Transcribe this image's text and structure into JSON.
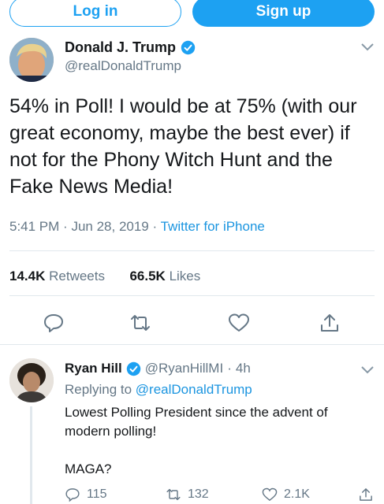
{
  "auth": {
    "login_label": "Log in",
    "signup_label": "Sign up"
  },
  "main_tweet": {
    "author_name": "Donald J. Trump",
    "author_handle": "@realDonaldTrump",
    "text": "54% in Poll! I would be at 75% (with our great economy, maybe the best ever) if not for the Phony Witch Hunt and the Fake News Media!",
    "time": "5:41 PM",
    "date": "Jun 28, 2019",
    "separator": "·",
    "source": "Twitter for iPhone",
    "retweets_count": "14.4K",
    "retweets_label": "Retweets",
    "likes_count": "66.5K",
    "likes_label": "Likes"
  },
  "reply_tweet": {
    "author_name": "Ryan Hill",
    "author_handle": "@RyanHillMI",
    "separator": "·",
    "age": "4h",
    "replying_prefix": "Replying to",
    "replying_to": "@realDonaldTrump",
    "text_line1": "Lowest Polling President since the advent of modern polling!",
    "text_line2": "MAGA?",
    "replies_count": "115",
    "retweets_count": "132",
    "likes_count": "2.1K"
  },
  "colors": {
    "accent": "#1da1f2",
    "link": "#1b95e0",
    "muted": "#657786",
    "text": "#14171a",
    "divider": "#e1e8ed"
  },
  "icons": [
    "verified-badge-icon",
    "chevron-down-icon",
    "reply-icon",
    "retweet-icon",
    "like-icon",
    "share-icon"
  ]
}
